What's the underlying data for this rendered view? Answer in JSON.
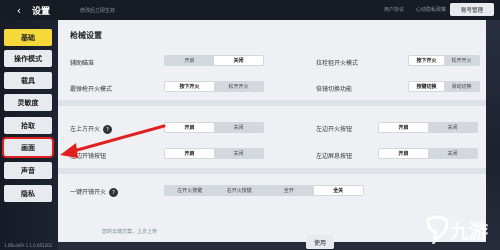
{
  "header": {
    "title": "设置",
    "hint": "修改后立即生效",
    "links": [
      "用户协议",
      "心动隐私政策"
    ],
    "account_button": "账号管理"
  },
  "sidebar": {
    "items": [
      {
        "label": "基础"
      },
      {
        "label": "操作模式"
      },
      {
        "label": "载具"
      },
      {
        "label": "灵敏度"
      },
      {
        "label": "拾取"
      },
      {
        "label": "画面"
      },
      {
        "label": "声音"
      },
      {
        "label": "隐私"
      }
    ]
  },
  "section": {
    "title": "枪械设置"
  },
  "rows": {
    "aim_assist": {
      "label": "辅助瞄准",
      "options": [
        "开启",
        "关闭"
      ],
      "selected": 1
    },
    "bolt_fire": {
      "label": "拉栓狙开火模式",
      "options": [
        "按下开火",
        "松开开火"
      ],
      "selected": 0
    },
    "shotgun_fire": {
      "label": "霰弹枪开火模式",
      "options": [
        "按下开火",
        "松开开火"
      ],
      "selected": 0
    },
    "scope_switch": {
      "label": "倍镜切换功能",
      "options": [
        "按键切换",
        "滑动切换"
      ],
      "selected": 0
    },
    "left_fire": {
      "label": "左上方开火",
      "options": [
        "开启",
        "关闭"
      ],
      "selected": 0
    },
    "left_fire_btn": {
      "label": "左边开火按钮",
      "options": [
        "开启",
        "关闭"
      ],
      "selected": 0
    },
    "left_scope_btn": {
      "label": "左边开镜按钮",
      "options": [
        "开启",
        "关闭"
      ],
      "selected": 0
    },
    "left_hold_btn": {
      "label": "左边屏息按钮",
      "options": [
        "开启",
        "关闭"
      ],
      "selected": 0
    },
    "one_key": {
      "label": "一键开镜开火",
      "options": [
        "左开火按键",
        "右开火按键",
        "全开",
        "全关"
      ],
      "selected": 3
    }
  },
  "notes": {
    "cloud": "您的云端方案，上次上传"
  },
  "buttons": {
    "use": "使用"
  },
  "footer": {
    "version": "1.0BuildPr 1.1.0.851202"
  },
  "watermark": {
    "text": "九游"
  }
}
